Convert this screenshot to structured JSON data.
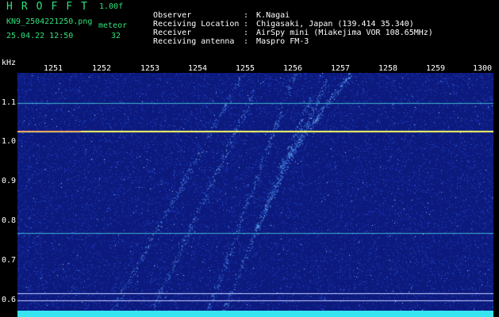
{
  "header": {
    "title": "HROFFT",
    "version": "1.00f",
    "filename": "KN9_2504221250.png",
    "meteor_label": "meteor",
    "datetime": "25.04.22 12:50",
    "meteor_count": "32"
  },
  "info": [
    {
      "label": "Observer",
      "value": "K.Nagai"
    },
    {
      "label": "Receiving Location",
      "value": "Chigasaki, Japan (139.414 35.340)"
    },
    {
      "label": "Receiver",
      "value": "AirSpy mini (Miakejima VOR 108.65MHz)"
    },
    {
      "label": "Receiving antenna",
      "value": "Maspro FM-3"
    }
  ],
  "axis": {
    "y_unit": "kHz",
    "x_ticks": [
      "1251",
      "1252",
      "1253",
      "1254",
      "1255",
      "1256",
      "1257",
      "1258",
      "1259",
      "1300"
    ],
    "y_ticks": [
      "1.1",
      "1.0",
      "0.9",
      "0.8",
      "0.7",
      "0.6"
    ]
  },
  "colors": {
    "background": "#000000",
    "header_text": "#2fe07a",
    "plot_bg": "#0d1d8a",
    "carrier_line": "#ffff60",
    "footer_bar": "#35e6f0"
  }
}
